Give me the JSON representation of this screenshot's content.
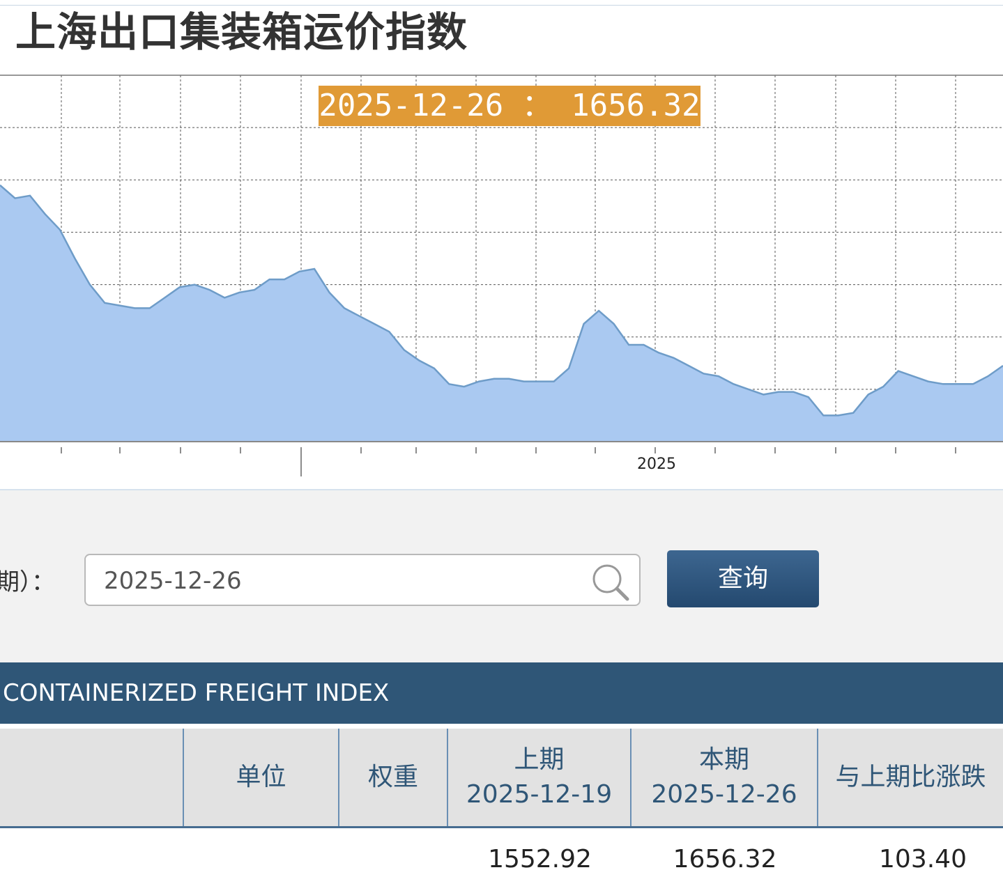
{
  "chart_data": {
    "type": "area",
    "title": "上海出口集装箱运价指数",
    "x_tick_label": "2025",
    "tooltip": "2025-12-26 ： 1656.32",
    "grid": true,
    "fill_color": "#aac9f1",
    "line_color": "#6e9cc8",
    "ylim": [
      0,
      7
    ],
    "values": [
      4.9,
      4.65,
      4.7,
      4.35,
      4.05,
      3.5,
      3.0,
      2.65,
      2.6,
      2.55,
      2.55,
      2.75,
      2.95,
      3.0,
      2.9,
      2.75,
      2.85,
      2.9,
      3.1,
      3.1,
      3.25,
      3.3,
      2.85,
      2.55,
      2.4,
      2.25,
      2.1,
      1.75,
      1.55,
      1.4,
      1.1,
      1.05,
      1.15,
      1.2,
      1.2,
      1.15,
      1.15,
      1.15,
      1.4,
      2.25,
      2.5,
      2.25,
      1.85,
      1.85,
      1.7,
      1.6,
      1.45,
      1.3,
      1.25,
      1.1,
      1.0,
      0.9,
      0.95,
      0.95,
      0.85,
      0.5,
      0.5,
      0.55,
      0.9,
      1.05,
      1.35,
      1.25,
      1.15,
      1.1,
      1.1,
      1.1,
      1.25,
      1.45
    ]
  },
  "form": {
    "date_label": "期）：",
    "date_value": "2025-12-26",
    "query_button": "查询"
  },
  "table": {
    "title": "CONTAINERIZED FREIGHT INDEX",
    "headers": {
      "unit": "单位",
      "weight": "权重",
      "prev_label": "上期",
      "prev_date": "2025-12-19",
      "curr_label": "本期",
      "curr_date": "2025-12-26",
      "change": "与上期比涨跌"
    },
    "row": {
      "prev": "1552.92",
      "curr": "1656.32",
      "change": "103.40"
    }
  }
}
